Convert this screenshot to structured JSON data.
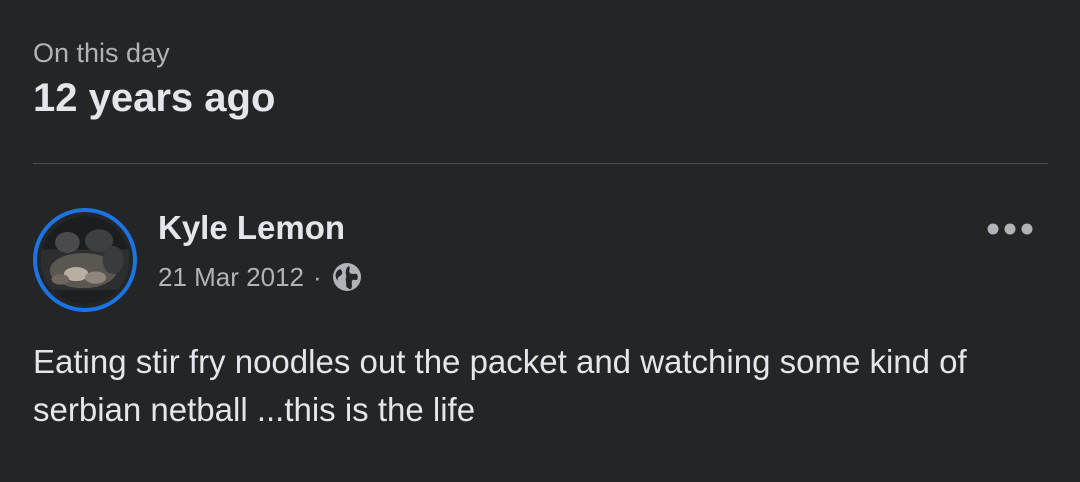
{
  "memory": {
    "overline": "On this day",
    "headline": "12 years ago"
  },
  "post": {
    "author": "Kyle Lemon",
    "date": "21 Mar 2012",
    "separator": "·",
    "privacy_icon": "globe-icon",
    "more_icon": "more-options-icon",
    "text": "Eating stir fry noodles out the packet and watching some kind of serbian netball ...this is the life"
  },
  "colors": {
    "background": "#242526",
    "primary_text": "#e4e6eb",
    "secondary_text": "#b0b3b8",
    "avatar_ring": "#1b74e4",
    "divider": "#4b4c4f"
  }
}
